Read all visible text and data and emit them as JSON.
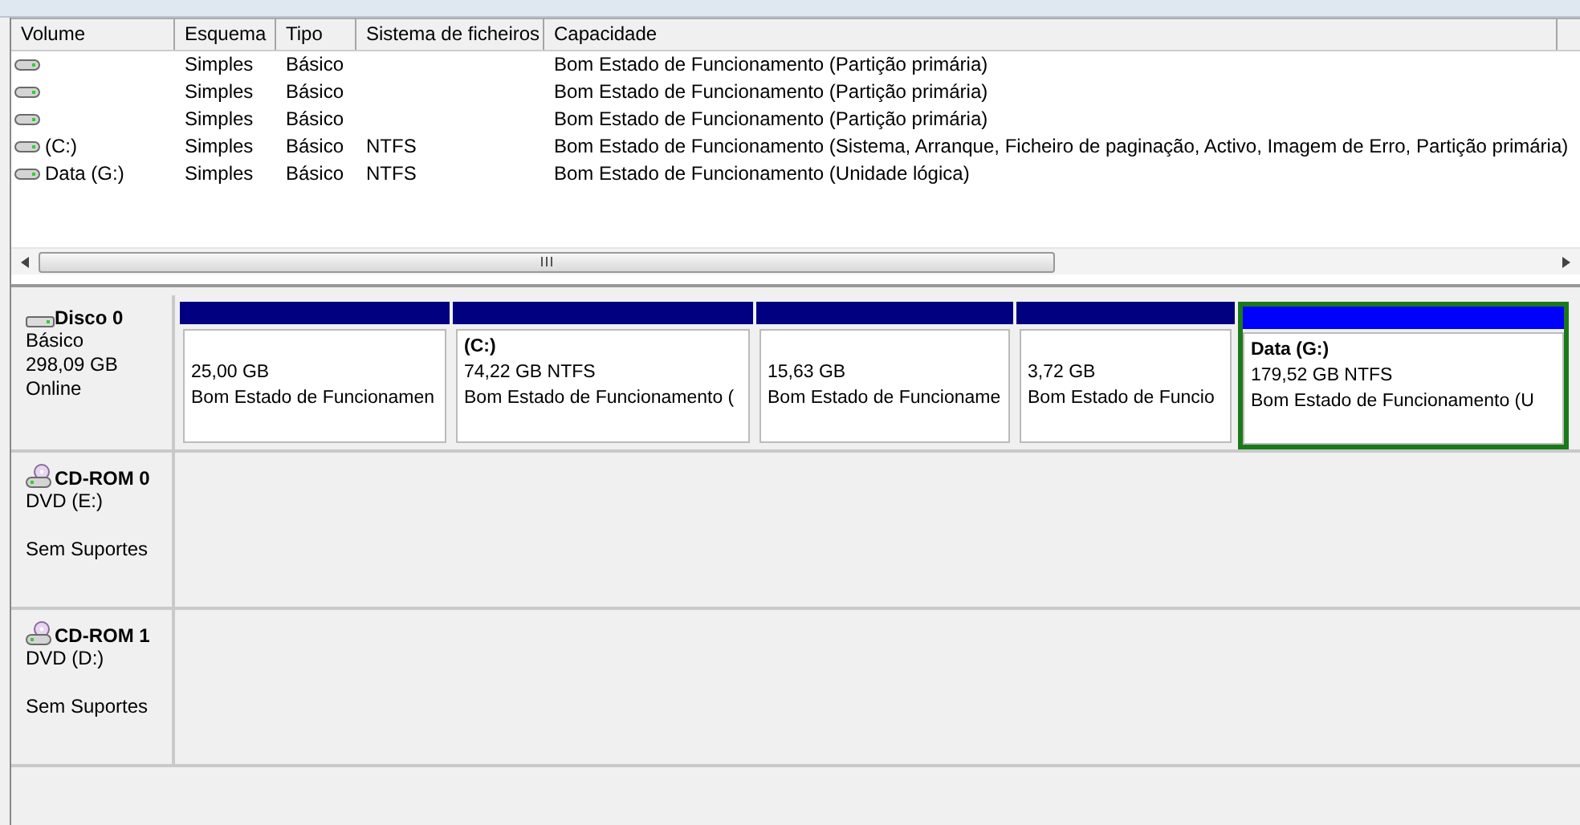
{
  "volume_table": {
    "columns": [
      "Volume",
      "Esquema",
      "Tipo",
      "Sistema de ficheiros",
      "Capacidade"
    ],
    "rows": [
      {
        "volume": "",
        "layout": "Simples",
        "type": "Básico",
        "file_system": "",
        "status": "Bom Estado de Funcionamento (Partição primária)"
      },
      {
        "volume": "",
        "layout": "Simples",
        "type": "Básico",
        "file_system": "",
        "status": "Bom Estado de Funcionamento (Partição primária)"
      },
      {
        "volume": "",
        "layout": "Simples",
        "type": "Básico",
        "file_system": "",
        "status": "Bom Estado de Funcionamento (Partição primária)"
      },
      {
        "volume": "(C:)",
        "layout": "Simples",
        "type": "Básico",
        "file_system": "NTFS",
        "status": "Bom Estado de Funcionamento (Sistema, Arranque, Ficheiro de paginação, Activo, Imagem de Erro, Partição primária)"
      },
      {
        "volume": "Data (G:)",
        "layout": "Simples",
        "type": "Básico",
        "file_system": "NTFS",
        "status": "Bom Estado de Funcionamento (Unidade lógica)"
      }
    ]
  },
  "disks": [
    {
      "kind": "disk",
      "name": "Disco 0",
      "lines": [
        "Básico",
        "298,09 GB",
        "Online"
      ],
      "partitions": [
        {
          "kind": "primary",
          "selected": false,
          "size": "25,00 GB",
          "status": "Bom Estado de Funcionamen"
        },
        {
          "kind": "primary",
          "selected": false,
          "label": "(C:)",
          "size": "74,22 GB NTFS",
          "status": "Bom Estado de Funcionamento ("
        },
        {
          "kind": "primary",
          "selected": false,
          "size": "15,63 GB",
          "status": "Bom Estado de Funcioname"
        },
        {
          "kind": "primary",
          "selected": false,
          "size": "3,72 GB",
          "status": "Bom Estado de Funcio"
        },
        {
          "kind": "logical",
          "selected": true,
          "label": "Data  (G:)",
          "size": "179,52 GB NTFS",
          "status": "Bom Estado de Funcionamento (U"
        }
      ]
    },
    {
      "kind": "cdrom",
      "name": "CD-ROM 0",
      "lines": [
        "DVD (E:)"
      ],
      "media_status": "Sem Suportes"
    },
    {
      "kind": "cdrom",
      "name": "CD-ROM 1",
      "lines": [
        "DVD (D:)"
      ],
      "media_status": "Sem Suportes"
    }
  ]
}
